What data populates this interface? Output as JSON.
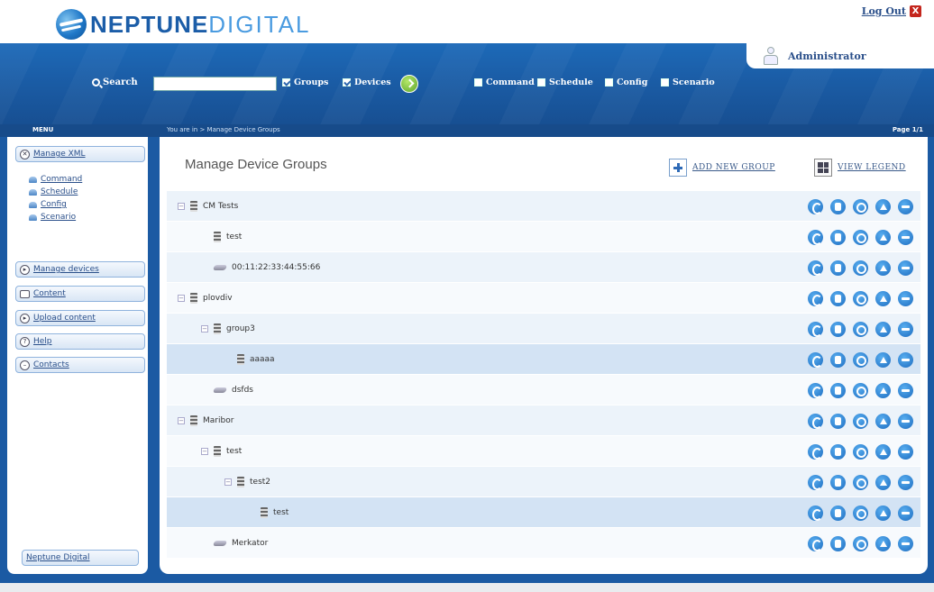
{
  "brand": {
    "part1": "NEPTUNE",
    "part2": "DIGITAL"
  },
  "header": {
    "logout_label": "Log Out",
    "logout_icon": "X",
    "user_name": "Administrator",
    "search": {
      "label": "Search",
      "value": "",
      "filters": [
        {
          "label": "Groups",
          "checked": true
        },
        {
          "label": "Devices",
          "checked": true
        }
      ]
    },
    "types": [
      {
        "label": "Command"
      },
      {
        "label": "Schedule"
      },
      {
        "label": "Config"
      },
      {
        "label": "Scenario"
      }
    ]
  },
  "strip": {
    "menu_label": "MENU",
    "breadcrumb": "You are in  >  Manage Device Groups",
    "page": "Page 1/1"
  },
  "sidebar": {
    "items": [
      {
        "label": "Manage XML",
        "icon": "circle-x-icon"
      },
      {
        "label": "Manage devices",
        "icon": "circle-play-icon"
      },
      {
        "label": "Content",
        "icon": "square-icon"
      },
      {
        "label": "Upload content",
        "icon": "circle-play-icon"
      },
      {
        "label": "Help",
        "icon": "circle-question-icon"
      },
      {
        "label": "Contacts",
        "icon": "circle-minus-icon"
      }
    ],
    "sub_items": [
      "Command",
      "Schedule",
      "Config",
      "Scenario"
    ],
    "footer": "Neptune Digital"
  },
  "main": {
    "title": "Manage Device Groups",
    "add_group": "ADD NEW GROUP",
    "view_legend": "VIEW LEGEND",
    "rows": [
      {
        "label": "CM Tests",
        "kind": "group",
        "level": 0,
        "expand": true,
        "style": "alt"
      },
      {
        "label": "test",
        "kind": "group",
        "level": 1,
        "expand": false,
        "style": "plain"
      },
      {
        "label": "00:11:22:33:44:55:66",
        "kind": "device",
        "level": 1,
        "expand": false,
        "style": "alt"
      },
      {
        "label": "plovdiv",
        "kind": "group",
        "level": 0,
        "expand": true,
        "style": "plain"
      },
      {
        "label": "group3",
        "kind": "group",
        "level": 1,
        "expand": true,
        "style": "alt"
      },
      {
        "label": "aaaaa",
        "kind": "group",
        "level": 2,
        "expand": false,
        "style": "hl"
      },
      {
        "label": "dsfds",
        "kind": "device",
        "level": 1,
        "expand": false,
        "style": "plain"
      },
      {
        "label": "Maribor",
        "kind": "group",
        "level": 0,
        "expand": true,
        "style": "alt"
      },
      {
        "label": "test",
        "kind": "group",
        "level": 1,
        "expand": true,
        "style": "plain"
      },
      {
        "label": "test2",
        "kind": "group",
        "level": 2,
        "expand": true,
        "style": "alt"
      },
      {
        "label": "test",
        "kind": "group",
        "level": 3,
        "expand": false,
        "style": "hl"
      },
      {
        "label": "Merkator",
        "kind": "device",
        "level": 1,
        "expand": false,
        "style": "plain"
      }
    ],
    "row_actions": [
      "edit-icon",
      "copy-icon",
      "search-icon",
      "move-up-icon",
      "delete-icon"
    ]
  },
  "colors": {
    "header_blue": "#1b5ea8",
    "link_blue": "#2a4f8a",
    "action_blue": "#1d6cc0",
    "highlight_row": "#d3e3f4",
    "logout_red": "#c4261d"
  }
}
